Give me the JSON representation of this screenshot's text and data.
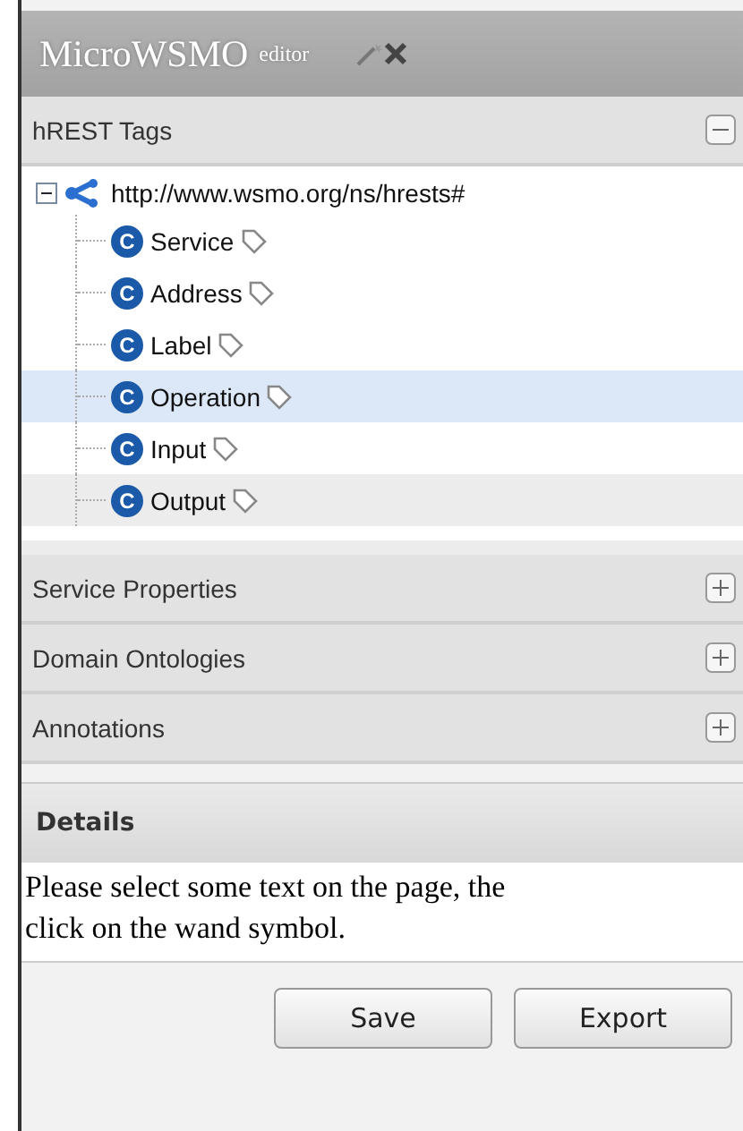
{
  "window": {
    "title": "MicroWSMO",
    "subtitle": "editor"
  },
  "sections": [
    {
      "title": "hREST Tags",
      "expanded": true,
      "tree": {
        "label": "http://www.wsmo.org/ns/hrests#",
        "expanded": true,
        "children": [
          {
            "label": "Service",
            "badge": "C",
            "selected": false,
            "hovered": false
          },
          {
            "label": "Address",
            "badge": "C",
            "selected": false,
            "hovered": false
          },
          {
            "label": "Label",
            "badge": "C",
            "selected": false,
            "hovered": false
          },
          {
            "label": "Operation",
            "badge": "C",
            "selected": true,
            "hovered": false
          },
          {
            "label": "Input",
            "badge": "C",
            "selected": false,
            "hovered": false
          },
          {
            "label": "Output",
            "badge": "C",
            "selected": false,
            "hovered": true
          }
        ]
      }
    },
    {
      "title": "Service Properties",
      "expanded": false
    },
    {
      "title": "Domain Ontologies",
      "expanded": false
    },
    {
      "title": "Annotations",
      "expanded": false
    }
  ],
  "details": {
    "title": "Details",
    "lines": [
      "Please select some text on the page, the",
      "click on the wand symbol."
    ]
  },
  "buttons": [
    "Save",
    "Export"
  ]
}
